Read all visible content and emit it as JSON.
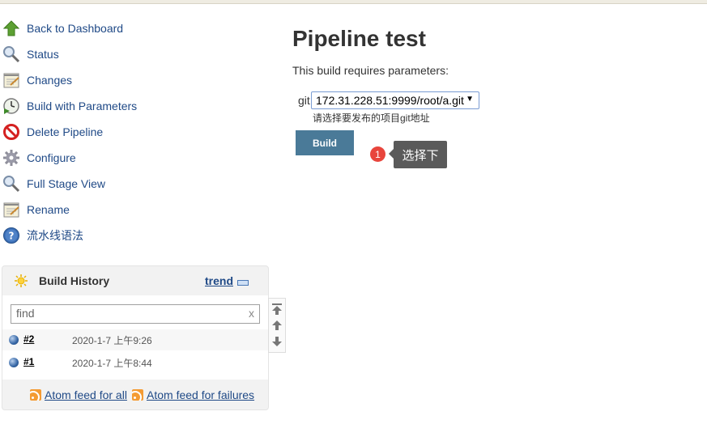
{
  "sidebar": {
    "items": [
      {
        "label": "Back to Dashboard",
        "icon": "up-arrow-icon"
      },
      {
        "label": "Status",
        "icon": "magnifier-icon"
      },
      {
        "label": "Changes",
        "icon": "notepad-icon"
      },
      {
        "label": "Build with Parameters",
        "icon": "clock-icon"
      },
      {
        "label": "Delete Pipeline",
        "icon": "no-entry-icon"
      },
      {
        "label": "Configure",
        "icon": "gear-icon"
      },
      {
        "label": "Full Stage View",
        "icon": "magnifier-icon"
      },
      {
        "label": "Rename",
        "icon": "notepad-icon"
      },
      {
        "label": "流水线语法",
        "icon": "help-icon"
      }
    ]
  },
  "build_history": {
    "title": "Build History",
    "trend_label": "trend",
    "search_placeholder": "find",
    "clear_label": "x",
    "builds": [
      {
        "number": "#2",
        "time": "2020-1-7 上午9:26"
      },
      {
        "number": "#1",
        "time": "2020-1-7 上午8:44"
      }
    ],
    "feed_all": "Atom feed for all",
    "feed_failures": "Atom feed for failures"
  },
  "main": {
    "title": "Pipeline test",
    "subtitle": "This build requires parameters:",
    "param_name": "git",
    "param_value": "172.31.228.51:9999/root/a.git",
    "param_help": "请选择要发布的项目git地址",
    "build_label": "Build"
  },
  "annotation": {
    "badge": "1",
    "tooltip": "选择下"
  },
  "colors": {
    "link": "#204a87",
    "build_button": "#4a7a98",
    "badge": "#e8453c"
  }
}
